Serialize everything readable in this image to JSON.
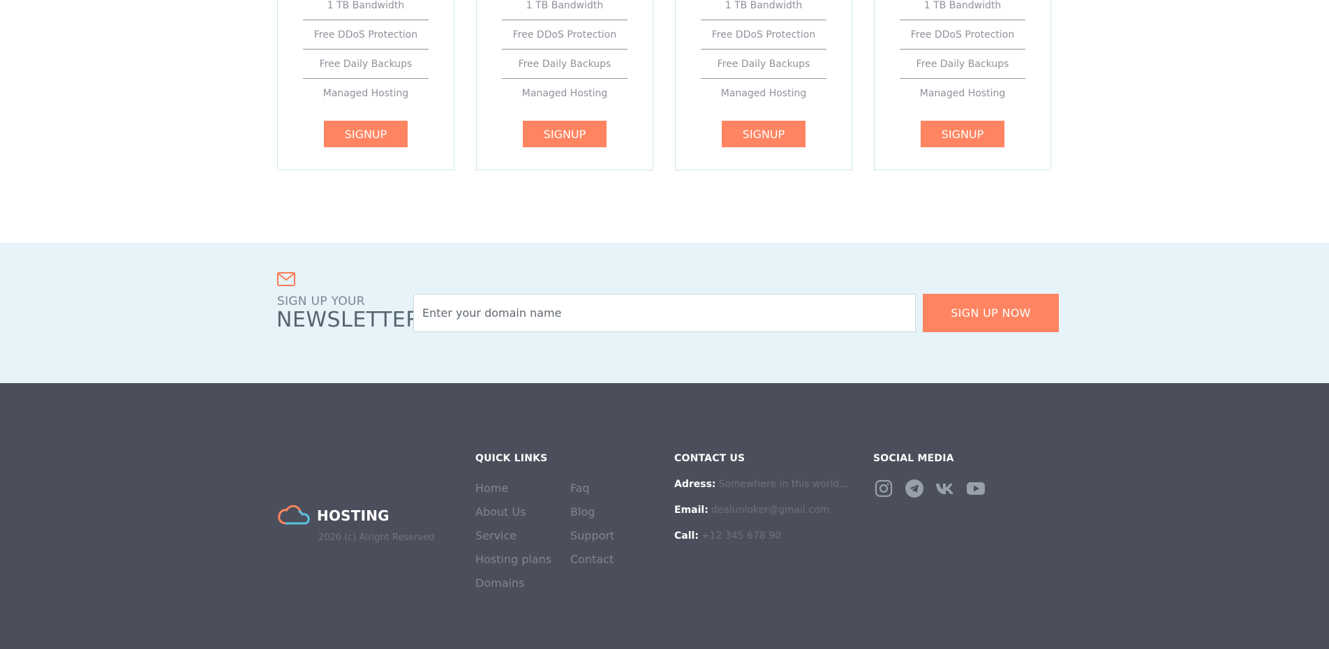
{
  "plans": [
    {
      "features": [
        "1 TB Bandwidth",
        "Free DDoS Protection",
        "Free Daily Backups",
        "Managed Hosting"
      ],
      "button": "SIGNUP"
    },
    {
      "features": [
        "1 TB Bandwidth",
        "Free DDoS Protection",
        "Free Daily Backups",
        "Managed Hosting"
      ],
      "button": "SIGNUP"
    },
    {
      "features": [
        "1 TB Bandwidth",
        "Free DDoS Protection",
        "Free Daily Backups",
        "Managed Hosting"
      ],
      "button": "SIGNUP"
    },
    {
      "features": [
        "1 TB Bandwidth",
        "Free DDoS Protection",
        "Free Daily Backups",
        "Managed Hosting"
      ],
      "button": "SIGNUP"
    }
  ],
  "newsletter": {
    "icon": "envelope-icon",
    "small_title": "SIGN UP YOUR",
    "big_title": "NEWSLETTER",
    "input_placeholder": "Enter your domain name",
    "input_value": "",
    "button": "SIGN UP NOW"
  },
  "footer": {
    "logo": {
      "icon": "cloud-icon",
      "text": "HOSTING"
    },
    "copyright": "2020 (c) Alright Reserved",
    "quick_links": {
      "title": "QUICK LINKS",
      "col1": [
        "Home",
        "About Us",
        "Service",
        "Hosting plans",
        "Domains"
      ],
      "col2": [
        "Faq",
        "Blog",
        "Support",
        "Contact"
      ]
    },
    "contact": {
      "title": "CONTACT US",
      "address_label": "Adress:",
      "address_value": "Somewhere in this world...",
      "email_label": "Email:",
      "email_value": "dealunloker@gmail.com",
      "call_label": "Call:",
      "call_value": "+12 345 678 90"
    },
    "social": {
      "title": "SOCIAL MEDIA",
      "icons": [
        "instagram-icon",
        "telegram-icon",
        "vk-icon",
        "youtube-icon"
      ]
    }
  },
  "colors": {
    "accent": "#ff8461",
    "newsletter_bg": "#e6f3f8",
    "footer_bg": "#4b4f5b",
    "card_border": "#cfe6ee"
  }
}
